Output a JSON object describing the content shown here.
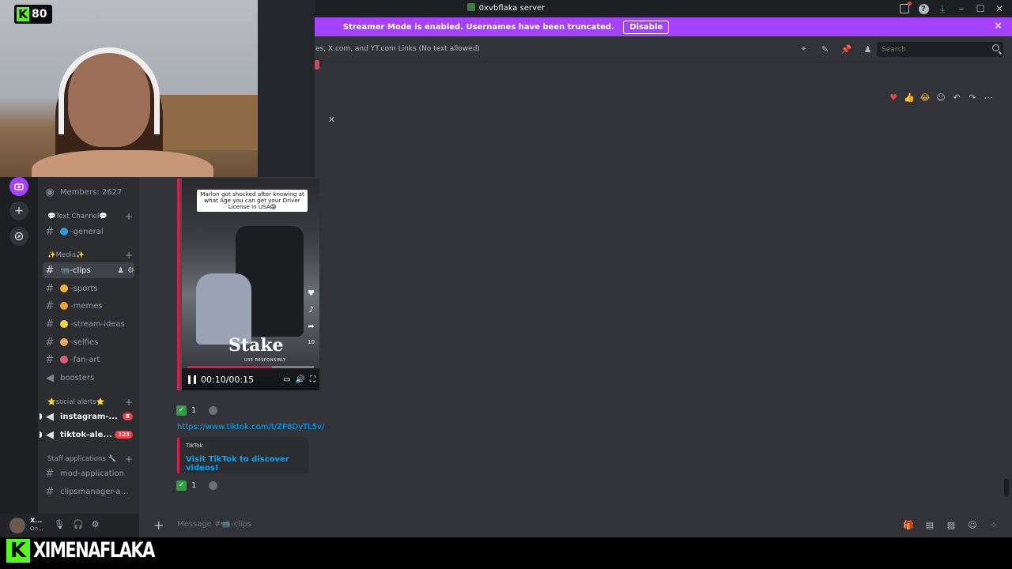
{
  "window": {
    "title": "0xvbflaka server"
  },
  "banner": {
    "text": "Streamer Mode is enabled. Usernames have been truncated.",
    "button": "Disable"
  },
  "header": {
    "topic": "es, X.com, and YT.com Links (No text allowed)",
    "search_placeholder": "Search"
  },
  "sidebar": {
    "members": "Members: 2627",
    "categories": {
      "text": "💬Text Channel💬",
      "media": "✨Media✨",
      "social": "⭐social alerts⭐",
      "staff": "Staff applications 🔧"
    },
    "channels": {
      "general": "-general",
      "clips": "📹-clips",
      "sports": "-sports",
      "memes": "-memes",
      "stream_ideas": "-stream-ideas",
      "selfies": "-selfies",
      "fan_art": "-fan-art",
      "boosters": "boosters",
      "instagram": "instagram-...",
      "tiktok": "tiktok-ale...",
      "mod_application": "mod-application",
      "clipsmanager": "clipsmanager-a..."
    },
    "badges": {
      "instagram": "8",
      "tiktok": "123"
    }
  },
  "message": {
    "video": {
      "caption": "Marlon got shocked after knowing at what Age you can get your Driver License in USA😱",
      "overlay_logo": "Stake",
      "overlay_sub": "USE RESPONSIBLY",
      "time": "00:10/00:15",
      "progress": 0.667,
      "side_count": "10"
    },
    "reaction_count": "1",
    "link": "https://www.tiktok.com/t/ZP8DyTL5v/",
    "embed": {
      "provider": "TikTok",
      "title": "Visit TikTok to discover videos!"
    },
    "reaction_count_2": "1"
  },
  "composer": {
    "placeholder": "Message #📹-clips"
  },
  "user": {
    "name": "X...",
    "status": "On..."
  },
  "overlay": {
    "streamer": "XIMENAFLAKA",
    "k_letter": "K",
    "viewer_count": "80"
  },
  "colors": {
    "brand": "#a442ff",
    "kick_green": "#53fc18",
    "tiktok_accent": "#e01b4a",
    "link": "#00a8fc"
  }
}
